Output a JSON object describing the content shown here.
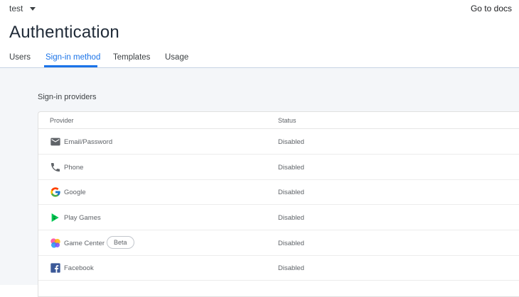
{
  "header": {
    "project": "test",
    "docs_link": "Go to docs"
  },
  "page": {
    "title": "Authentication"
  },
  "tabs": [
    {
      "label": "Users",
      "active": false
    },
    {
      "label": "Sign-in method",
      "active": true
    },
    {
      "label": "Templates",
      "active": false
    },
    {
      "label": "Usage",
      "active": false
    }
  ],
  "section": {
    "label": "Sign-in providers"
  },
  "table": {
    "headers": {
      "provider": "Provider",
      "status": "Status"
    },
    "rows": [
      {
        "name": "Email/Password",
        "status": "Disabled",
        "icon": "mail-icon"
      },
      {
        "name": "Phone",
        "status": "Disabled",
        "icon": "phone-icon"
      },
      {
        "name": "Google",
        "status": "Disabled",
        "icon": "google-icon"
      },
      {
        "name": "Play Games",
        "status": "Disabled",
        "icon": "play-games-icon"
      },
      {
        "name": "Game Center",
        "status": "Disabled",
        "icon": "game-center-icon",
        "badge": "Beta"
      },
      {
        "name": "Facebook",
        "status": "Disabled",
        "icon": "facebook-icon"
      }
    ]
  },
  "colors": {
    "accent": "#1a73e8",
    "content_background": "#f4f6f9",
    "facebook": "#3b5998"
  }
}
